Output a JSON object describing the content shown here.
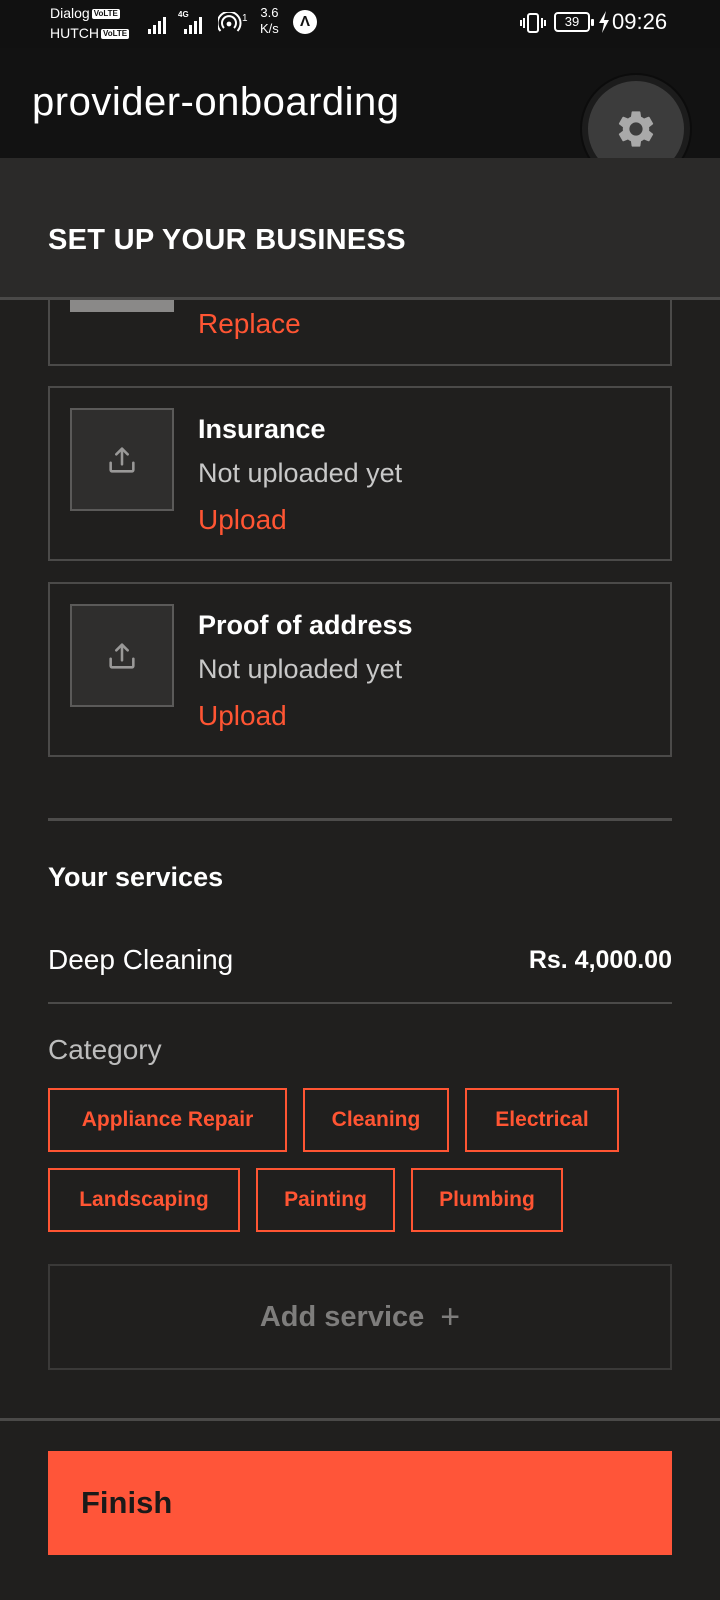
{
  "status_bar": {
    "carrier_1": "Dialog",
    "carrier_2": "HUTCH",
    "volte_badge": "VoLTE",
    "network_type": "4G",
    "hotspot_count": "1",
    "speed_value": "3.6",
    "speed_unit": "K/s",
    "app_icon_glyph": "Λ",
    "battery": "39",
    "time": "09:26"
  },
  "app_bar": {
    "title": "provider-onboarding",
    "settings_icon": "gear-icon"
  },
  "section": {
    "title": "SET UP YOUR BUSINESS"
  },
  "documents": {
    "previous_action": "Replace",
    "items": [
      {
        "title": "Insurance",
        "status": "Not uploaded yet",
        "action": "Upload",
        "icon": "upload-icon"
      },
      {
        "title": "Proof of address",
        "status": "Not uploaded yet",
        "action": "Upload",
        "icon": "upload-icon"
      }
    ]
  },
  "services": {
    "title": "Your services",
    "items": [
      {
        "name": "Deep Cleaning",
        "price": "Rs. 4,000.00"
      }
    ],
    "category_label": "Category",
    "categories": [
      "Appliance Repair",
      "Cleaning",
      "Electrical",
      "Landscaping",
      "Painting",
      "Plumbing"
    ],
    "add_label": "Add service",
    "add_icon": "+"
  },
  "footer": {
    "finish_label": "Finish"
  },
  "colors": {
    "accent": "#ff5533",
    "background": "#201f1e",
    "app_bar": "#121212",
    "header": "#2b2a29"
  }
}
